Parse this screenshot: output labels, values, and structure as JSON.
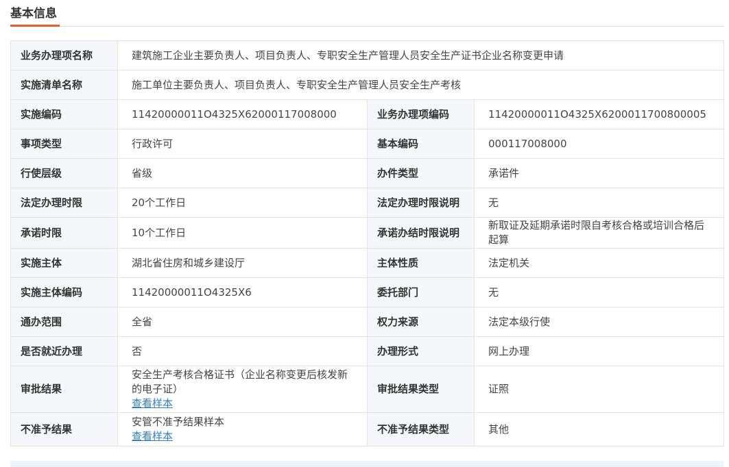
{
  "section": {
    "title": "基本信息"
  },
  "rows": {
    "r0": {
      "label": "业务办理项名称",
      "value": "建筑施工企业主要负责人、项目负责人、专职安全生产管理人员安全生产证书企业名称变更申请"
    },
    "r1": {
      "label": "实施清单名称",
      "value": "施工单位主要负责人、项目负责人、专职安全生产管理人员安全生产考核"
    },
    "r2": {
      "l1": "实施编码",
      "v1": "11420000011O4325X62000117008000",
      "l2": "业务办理项编码",
      "v2": "11420000011O4325X6200011700800005"
    },
    "r3": {
      "l1": "事项类型",
      "v1": "行政许可",
      "l2": "基本编码",
      "v2": "000117008000"
    },
    "r4": {
      "l1": "行使层级",
      "v1": "省级",
      "l2": "办件类型",
      "v2": "承诺件"
    },
    "r5": {
      "l1": "法定办理时限",
      "v1": "20个工作日",
      "l2": "法定办理时限说明",
      "v2": "无"
    },
    "r6": {
      "l1": "承诺时限",
      "v1": "10个工作日",
      "l2": "承诺办结时限说明",
      "v2": "新取证及延期承诺时限自考核合格或培训合格后起算"
    },
    "r7": {
      "l1": "实施主体",
      "v1": "湖北省住房和城乡建设厅",
      "l2": "主体性质",
      "v2": "法定机关"
    },
    "r8": {
      "l1": "实施主体编码",
      "v1": "11420000011O4325X6",
      "l2": "委托部门",
      "v2": "无"
    },
    "r9": {
      "l1": "通办范围",
      "v1": "全省",
      "l2": "权力来源",
      "v2": "法定本级行使"
    },
    "r10": {
      "l1": "是否就近办理",
      "v1": "否",
      "l2": "办理形式",
      "v2": "网上办理"
    },
    "r11": {
      "l1": "审批结果",
      "v1": "安全生产考核合格证书（企业名称变更后核发新的电子证）",
      "link": "查看样本",
      "l2": "审批结果类型",
      "v2": "证照"
    },
    "r12": {
      "l1": "不准予结果",
      "v1": "安管不准予结果样本",
      "link": "查看样本",
      "l2": "不准予结果类型",
      "v2": "其他"
    }
  },
  "colors": {
    "accent": "#f05a28",
    "label_bg": "#f5f7fa",
    "link": "#2a7ecb",
    "border": "#e3e3e3"
  }
}
